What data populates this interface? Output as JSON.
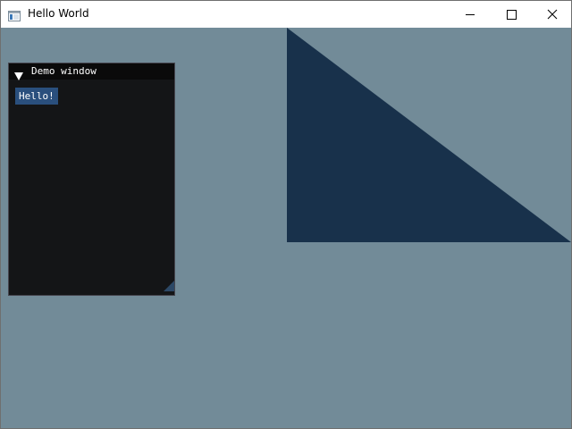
{
  "window": {
    "title": "Hello World",
    "icon": "app-window-icon",
    "controls": {
      "minimize_icon": "minimize-icon",
      "maximize_icon": "maximize-icon",
      "close_icon": "close-icon"
    }
  },
  "scene": {
    "background_color": "#728b98",
    "triangle_color": "#18314b"
  },
  "demo_window": {
    "title": "Demo window",
    "collapse_icon": "collapse-arrow-icon",
    "button_label": "Hello!",
    "button_color": "#2a4f7d",
    "body_color": "#141517",
    "title_color": "#0a0a0a"
  }
}
